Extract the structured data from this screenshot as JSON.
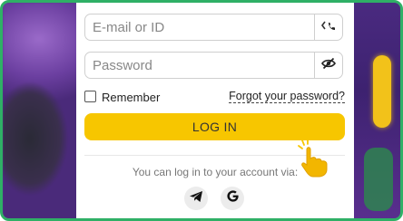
{
  "login": {
    "email_placeholder": "E-mail or ID",
    "password_placeholder": "Password",
    "remember_label": "Remember",
    "forgot_label": "Forgot your password?",
    "login_button": "LOG IN",
    "via_text": "You can log in to your account via:"
  },
  "icons": {
    "phone_toggle": "phone-icon",
    "password_toggle": "eye-slash-icon",
    "telegram": "telegram-icon",
    "google": "google-icon",
    "pointer": "pointing-hand-icon"
  },
  "colors": {
    "accent_yellow": "#f7c600",
    "frame_green": "#2fb066",
    "background_purple": "#5b3a8a"
  }
}
